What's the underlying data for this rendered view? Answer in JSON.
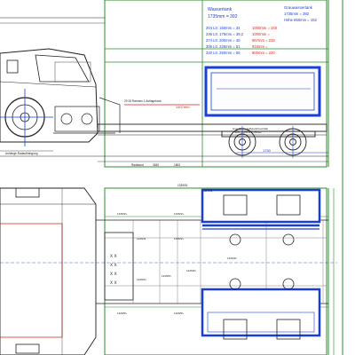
{
  "water_tank": {
    "title": "Wassertank",
    "capacity": "1735mm = 392",
    "rows": [
      {
        "black": "204 Ltr. 150mm = 34",
        "red": "1000mm = 240"
      },
      {
        "black": "236 Ltr. 175mm = 39,2",
        "red": "1000mm ="
      },
      {
        "black": "274 Ltr. 200mm = 45",
        "red": "967mm = 233"
      },
      {
        "black": "306 Ltr. 225mm = 51",
        "red": "934mm ="
      },
      {
        "black": "340 Ltr. 250mm = 56",
        "red": "900mm = 220"
      }
    ]
  },
  "grey_water": {
    "title": "Grauwassertank",
    "line1": "1735mm = 392",
    "line2": "Höhe 850mm = 152"
  },
  "annotations": {
    "side_red_dim": "1407mm",
    "side_label_a": "29 28 Rahmen 1 Auflagebock",
    "side_label_b": "Grundfläche Aufbaurahmenhalle",
    "side_label_c": "siehe Zeichnung 158422",
    "side_lower_left": "Anhänge-Radaufhängung",
    "dim_1750": "1750",
    "radstand": "Radstand",
    "dim_3450": "3450",
    "dim_1800": "1800",
    "plan_top_a": "1339/51",
    "plan_top_b": "1329/51",
    "plan_dims": [
      "1335/31",
      "1335/41",
      "1329/11",
      "1335/41",
      "1329/41",
      "1329/51",
      "1329/31",
      "1329/31",
      "1329/51",
      "1329/51"
    ]
  },
  "colors": {
    "frame_green": "#2e8b2e",
    "tank_blue": "#1a3fd9",
    "annotation_red": "#d9231a",
    "linework": "#222222"
  }
}
